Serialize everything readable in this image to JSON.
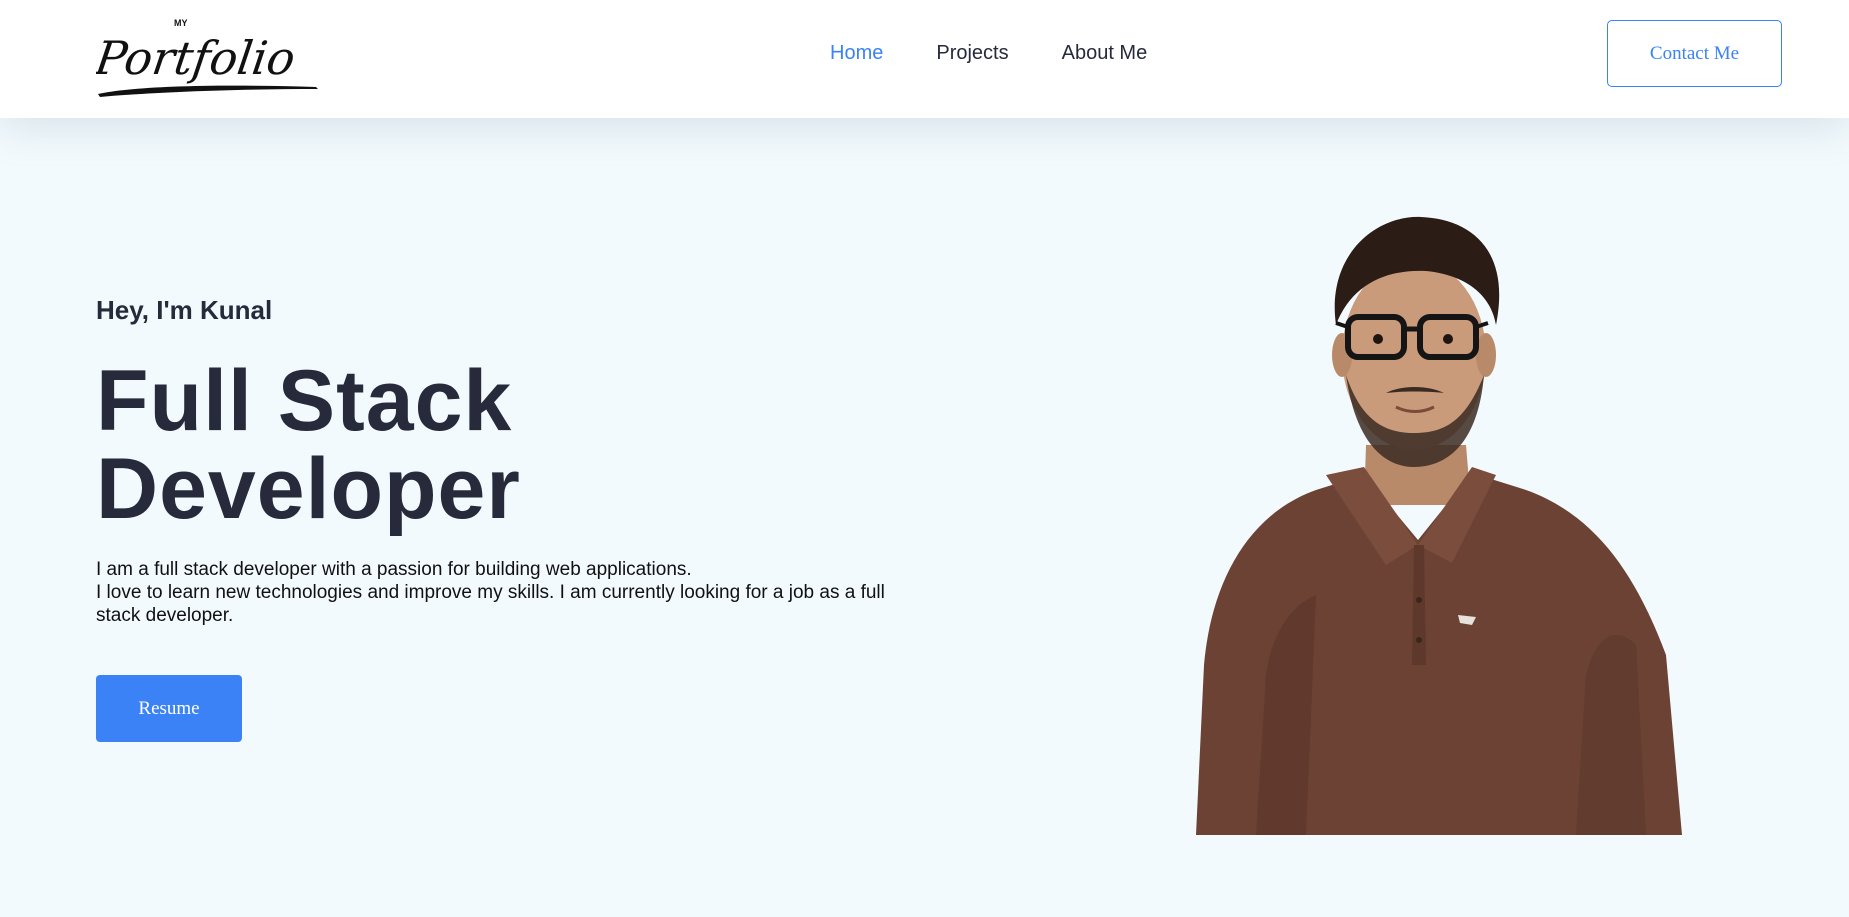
{
  "header": {
    "logo": {
      "small_text": "MY",
      "script_text": "Portfolio"
    },
    "nav": [
      {
        "label": "Home",
        "active": true
      },
      {
        "label": "Projects",
        "active": false
      },
      {
        "label": "About Me",
        "active": false
      }
    ],
    "contact_label": "Contact Me"
  },
  "hero": {
    "greeting": "Hey, I'm Kunal",
    "headline_line1": "Full Stack",
    "headline_line2": "Developer",
    "description_line1": "I am a full stack developer with a passion for building web applications.",
    "description_line2": "I love to learn new technologies and improve my skills. I am currently looking for a job as a full stack developer.",
    "resume_label": "Resume"
  },
  "colors": {
    "accent": "#3b82f6",
    "text_dark": "#262a3b",
    "page_background": "#f3fafd",
    "header_background": "#ffffff",
    "shirt": "#6b4233"
  }
}
